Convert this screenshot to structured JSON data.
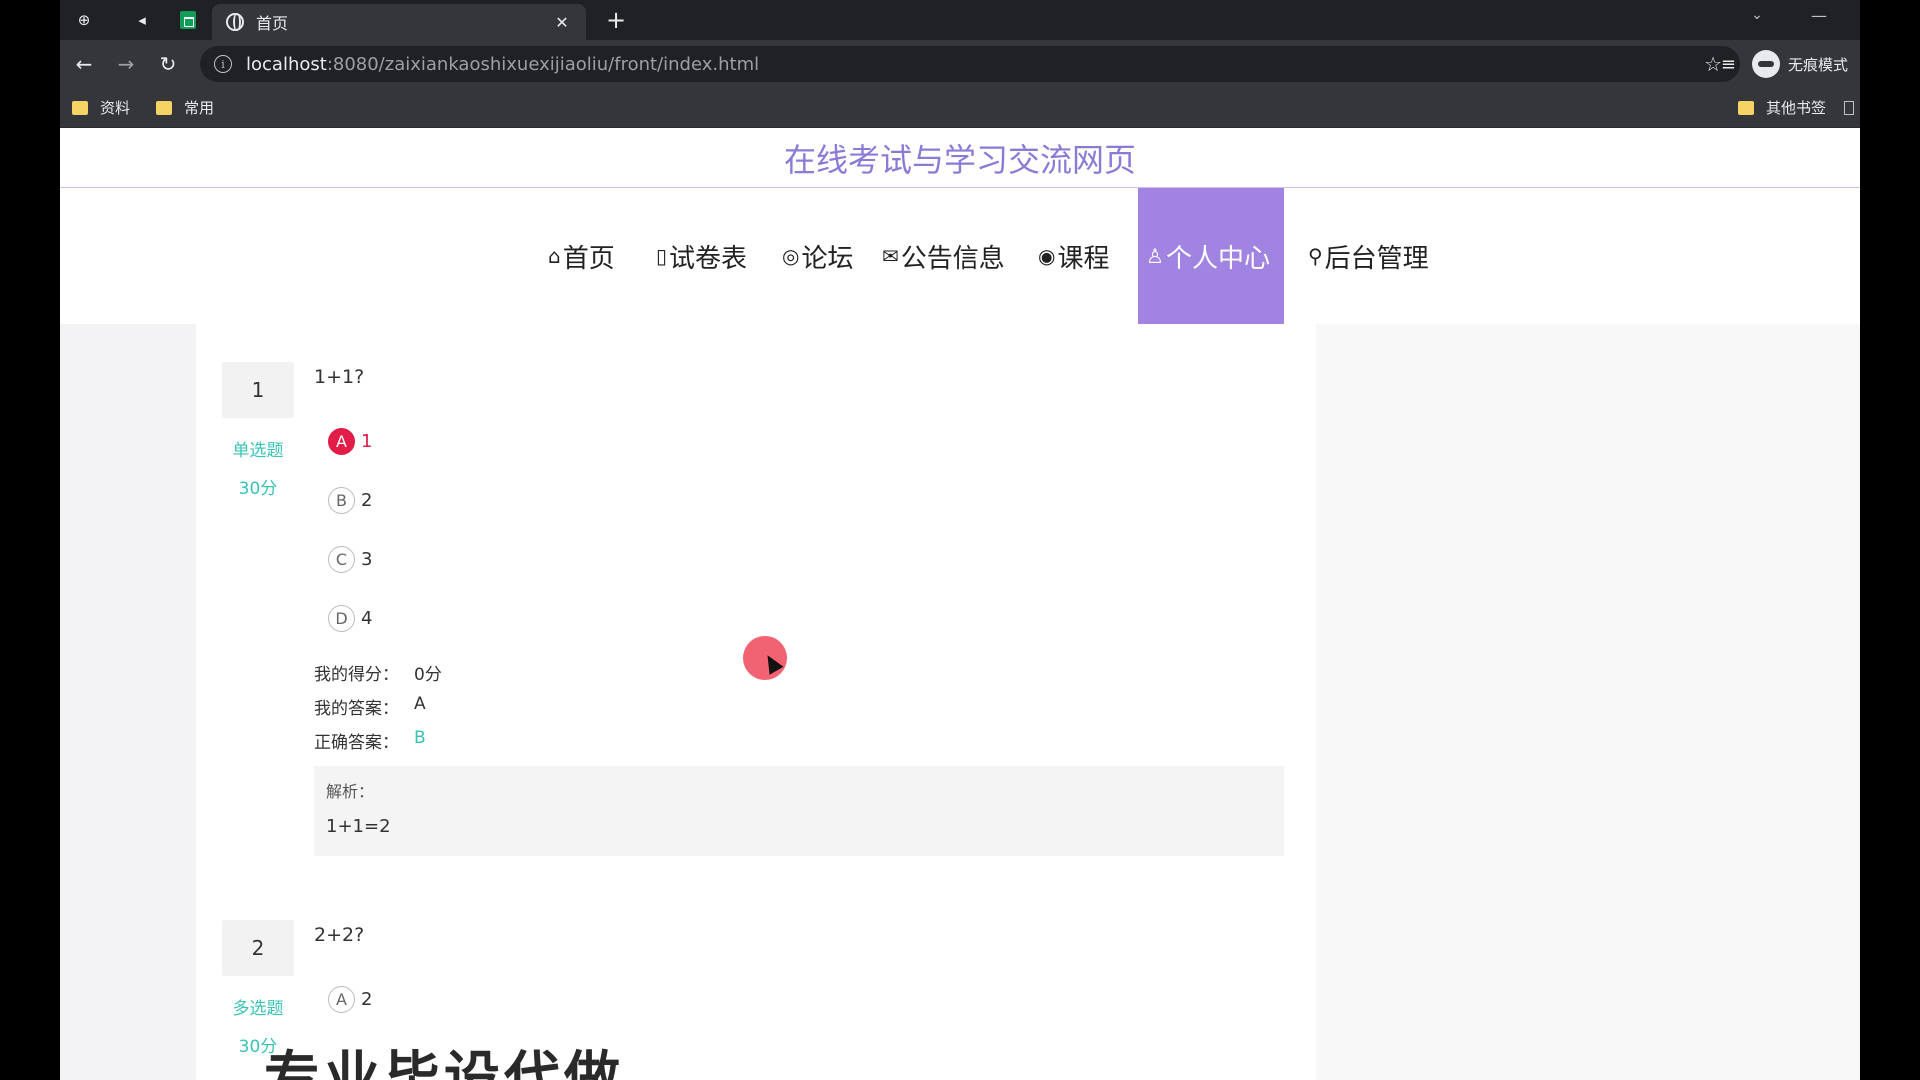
{
  "browser": {
    "tab_title": "首页",
    "url_host": "localhost",
    "url_path": ":8080/zaixiankaoshixuexijiaoliu/front/index.html",
    "profile_label": "无痕模式",
    "bookmarks": [
      {
        "label": "资料"
      },
      {
        "label": "常用"
      }
    ],
    "other_bookmarks": "其他书签"
  },
  "site": {
    "title": "在线考试与学习交流网页",
    "nav": [
      {
        "icon": "home-icon",
        "glyph": "⌂",
        "label": "首页"
      },
      {
        "icon": "exam-icon",
        "glyph": "▯",
        "label": "试卷表"
      },
      {
        "icon": "forum-icon",
        "glyph": "◎",
        "label": "论坛"
      },
      {
        "icon": "notice-icon",
        "glyph": "✉",
        "label": "公告信息"
      },
      {
        "icon": "course-icon",
        "glyph": "◉",
        "label": "课程"
      },
      {
        "icon": "user-icon",
        "glyph": "♙",
        "label": "个人中心",
        "active": true
      },
      {
        "icon": "link-icon",
        "glyph": "⚲",
        "label": "后台管理"
      }
    ]
  },
  "questions": [
    {
      "number": "1",
      "type": "单选题",
      "score": "30分",
      "text": "1+1?",
      "options": [
        {
          "letter": "A",
          "value": "1",
          "selected": true
        },
        {
          "letter": "B",
          "value": "2"
        },
        {
          "letter": "C",
          "value": "3"
        },
        {
          "letter": "D",
          "value": "4"
        }
      ],
      "result": {
        "my_score_label": "我的得分：",
        "my_score": "0分",
        "my_answer_label": "我的答案：",
        "my_answer": "A",
        "correct_label": "正确答案：",
        "correct": "B"
      },
      "analysis": {
        "label": "解析：",
        "text": "1+1=2"
      }
    },
    {
      "number": "2",
      "type": "多选题",
      "score": "30分",
      "text": "2+2?",
      "options": [
        {
          "letter": "A",
          "value": "2"
        }
      ]
    }
  ],
  "overlay_text": "专业毕设代做",
  "colors": {
    "accent": "#a184e2",
    "title": "#8c7bd6",
    "teal": "#39c3b6",
    "selected": "#e11d48"
  }
}
